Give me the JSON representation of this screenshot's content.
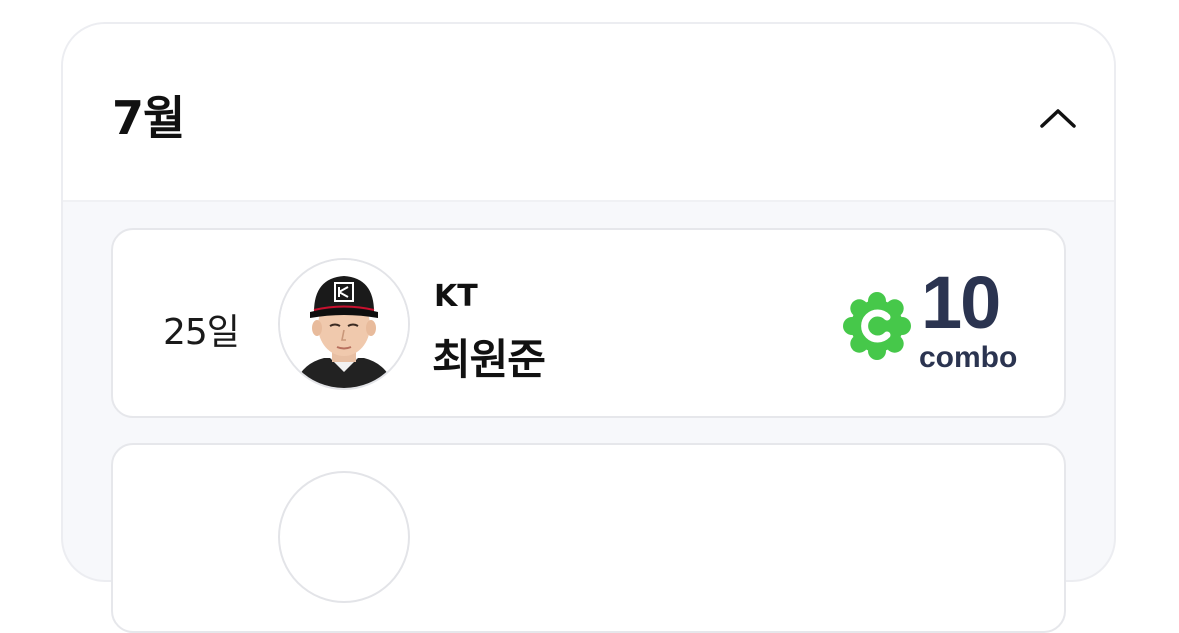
{
  "month_section": {
    "title": "7월",
    "expanded": true,
    "entries": [
      {
        "day": "25일",
        "team": "KT",
        "player_name": "최원준",
        "combo_count": "10",
        "combo_label": "combo",
        "combo_icon": "green-c-badge-icon"
      }
    ]
  },
  "colors": {
    "combo_badge": "#46c84a",
    "combo_text": "#2b3450",
    "panel_background": "#f7f8fb"
  }
}
